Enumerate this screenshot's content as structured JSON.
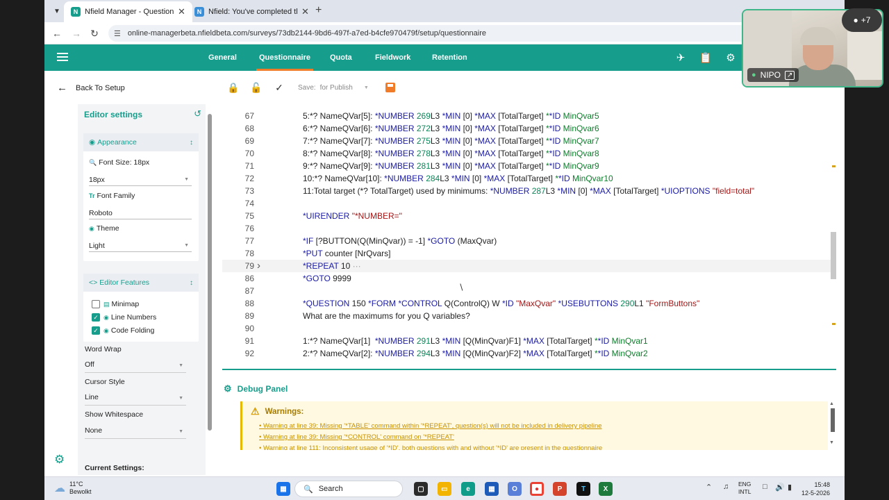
{
  "browser": {
    "tabs": [
      {
        "title": "Nfield Manager - Questionnaire",
        "active": true
      },
      {
        "title": "Nfield: You've completed this s",
        "active": false
      }
    ],
    "url": "online-managerbeta.nfieldbeta.com/surveys/73db2144-9bd6-497f-a7ed-b4cfe970479f/setup/questionnaire"
  },
  "header": {
    "tabs": [
      "General",
      "Questionnaire",
      "Quota",
      "Fieldwork",
      "Retention"
    ],
    "active_tab": "Questionnaire",
    "accent_color": "#169d8b",
    "highlight_color": "#f07c2a"
  },
  "sidebar": {
    "back_label": "Back To Setup",
    "editor_settings_title": "Editor settings",
    "appearance": {
      "title": "Appearance",
      "font_size_label": "Font Size: 18px",
      "font_size_value": "18px",
      "font_family_label": "Font Family",
      "font_family_value": "Roboto",
      "theme_label": "Theme",
      "theme_value": "Light"
    },
    "features": {
      "title": "Editor Features",
      "minimap_label": "Minimap",
      "minimap_checked": false,
      "line_numbers_label": "Line Numbers",
      "line_numbers_checked": true,
      "code_folding_label": "Code Folding",
      "code_folding_checked": true
    },
    "word_wrap_label": "Word Wrap",
    "word_wrap_value": "Off",
    "cursor_style_label": "Cursor Style",
    "cursor_style_value": "Line",
    "show_whitespace_label": "Show Whitespace",
    "show_whitespace_value": "None",
    "current_settings_label": "Current Settings:"
  },
  "toolbar": {
    "save_label": "Save:",
    "save_value": "for Publish"
  },
  "editor": {
    "lines": [
      {
        "num": "67",
        "text": "5:*? NameQVar[5]: *NUMBER 269L3 *MIN [0] *MAX [TotalTarget] **ID MinQvar5"
      },
      {
        "num": "68",
        "text": "6:*? NameQVar[6]: *NUMBER 272L3 *MIN [0] *MAX [TotalTarget] **ID MinQvar6"
      },
      {
        "num": "69",
        "text": "7:*? NameQVar[7]: *NUMBER 275L3 *MIN [0] *MAX [TotalTarget] **ID MinQvar7"
      },
      {
        "num": "70",
        "text": "8:*? NameQVar[8]: *NUMBER 278L3 *MIN [0] *MAX [TotalTarget] **ID MinQvar8"
      },
      {
        "num": "71",
        "text": "9:*? NameQVar[9]: *NUMBER 281L3 *MIN [0] *MAX [TotalTarget] **ID MinQvar9"
      },
      {
        "num": "72",
        "text": "10:*? NameQVar[10]: *NUMBER 284L3 *MIN [0] *MAX [TotalTarget] **ID MinQvar10"
      },
      {
        "num": "73",
        "text": "11:Total target (*? TotalTarget) used by minimums: *NUMBER 287L3 *MIN [0] *MAX [TotalTarget] *UIOPTIONS \"field=total\""
      },
      {
        "num": "74",
        "text": ""
      },
      {
        "num": "75",
        "text": "*UIRENDER \"*NUMBER=\""
      },
      {
        "num": "76",
        "text": ""
      },
      {
        "num": "77",
        "text": "*IF [?BUTTON(Q(MinQvar)) = -1] *GOTO (MaxQvar)"
      },
      {
        "num": "78",
        "text": "*PUT counter [NrQvars]"
      },
      {
        "num": "79",
        "text": "*REPEAT 10 ···"
      },
      {
        "num": "86",
        "text": "*GOTO 9999"
      },
      {
        "num": "87",
        "text": ""
      },
      {
        "num": "88",
        "text": "*QUESTION 150 *FORM *CONTROL Q(ControlQ) W *ID \"MaxQvar\" *USEBUTTONS 290L1 \"FormButtons\""
      },
      {
        "num": "89",
        "text": "What are the maximums for you Q variables?"
      },
      {
        "num": "90",
        "text": ""
      },
      {
        "num": "91",
        "text": "1:*? NameQVar[1]  *NUMBER 291L3 *MIN [Q(MinQvar)F1] *MAX [TotalTarget] **ID MinQvar1"
      },
      {
        "num": "92",
        "text": "2:*? NameQVar[2]: *NUMBER 294L3 *MIN [Q(MinQvar)F2] *MAX [TotalTarget] **ID MinQvar2"
      }
    ]
  },
  "debug": {
    "title": "Debug Panel",
    "warnings_title": "Warnings:",
    "warnings": [
      "Warning at line 39: Missing '*TABLE' command within '*REPEAT', question(s) will not be included in delivery pipeline",
      "Warning at line 39: Missing '*CONTROL' command on '*REPEAT'",
      "Warning at line 111: Inconsistent usage of '*ID', both questions with and without '*ID' are present in the questionnaire"
    ]
  },
  "video": {
    "name": "NIPO",
    "participants_badge": "+7"
  },
  "taskbar": {
    "temperature": "11°C",
    "weather": "Bewolkt",
    "search_placeholder": "Search",
    "lang_1": "ENG",
    "lang_2": "INTL",
    "time": "15:48",
    "date": "12-5-2026"
  }
}
